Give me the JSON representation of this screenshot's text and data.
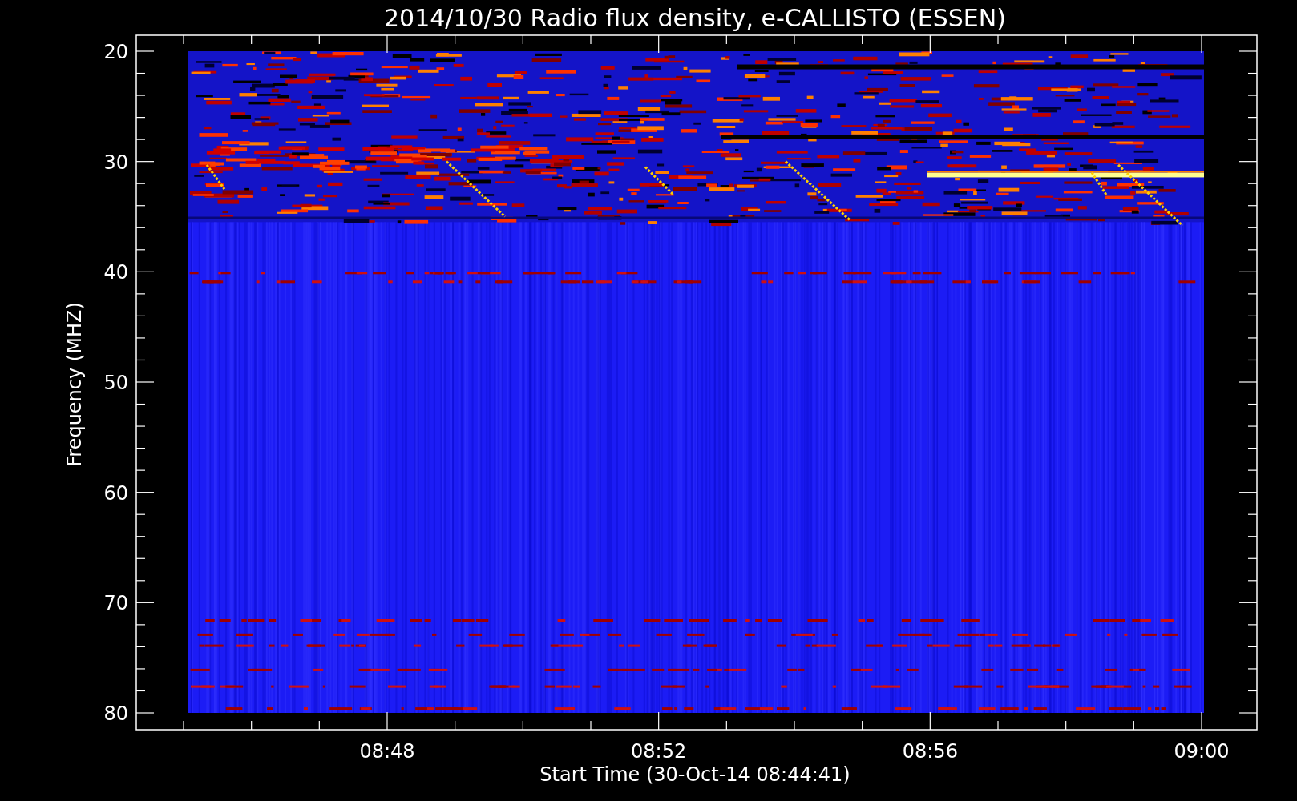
{
  "title": "2014/10/30  Radio flux density, e-CALLISTO (ESSEN)",
  "y_axis": {
    "title": "Frequency (MHZ)",
    "tick_labels": [
      "20",
      "30",
      "40",
      "50",
      "60",
      "70",
      "80"
    ]
  },
  "x_axis": {
    "title": "Start Time (30-Oct-14 08:44:41)",
    "tick_labels": [
      "08:48",
      "08:52",
      "08:56",
      "09:00"
    ]
  }
}
